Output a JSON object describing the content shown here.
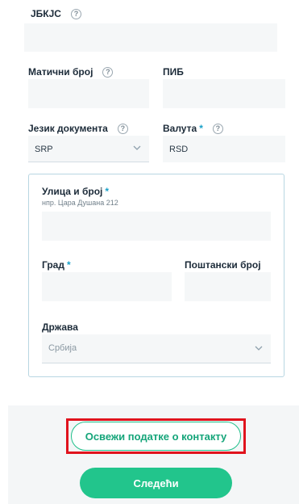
{
  "fields": {
    "jbkjs": {
      "label": "ЈБКЈС",
      "value": ""
    },
    "maticni_broj": {
      "label": "Матични број",
      "value": ""
    },
    "pib": {
      "label": "ПИБ",
      "value": ""
    },
    "jezik_dokumenta": {
      "label": "Језик документа",
      "value": "SRP"
    },
    "valuta": {
      "label": "Валута",
      "required": "*",
      "value": "RSD"
    }
  },
  "address": {
    "ulica": {
      "label": "Улица и број",
      "required": "*",
      "hint": "нпр. Цара Душана 212",
      "value": ""
    },
    "grad": {
      "label": "Град",
      "required": "*",
      "value": ""
    },
    "postanski_broj": {
      "label": "Поштански број",
      "value": ""
    },
    "drzava": {
      "label": "Држава",
      "value": "Србија"
    }
  },
  "buttons": {
    "refresh_contact": "Освежи податке о контакту",
    "next": "Следећи"
  },
  "icons": {
    "help": "?"
  },
  "colors": {
    "accent": "#22c58c",
    "highlight": "#e0131d",
    "required": "#1aa0c8"
  }
}
